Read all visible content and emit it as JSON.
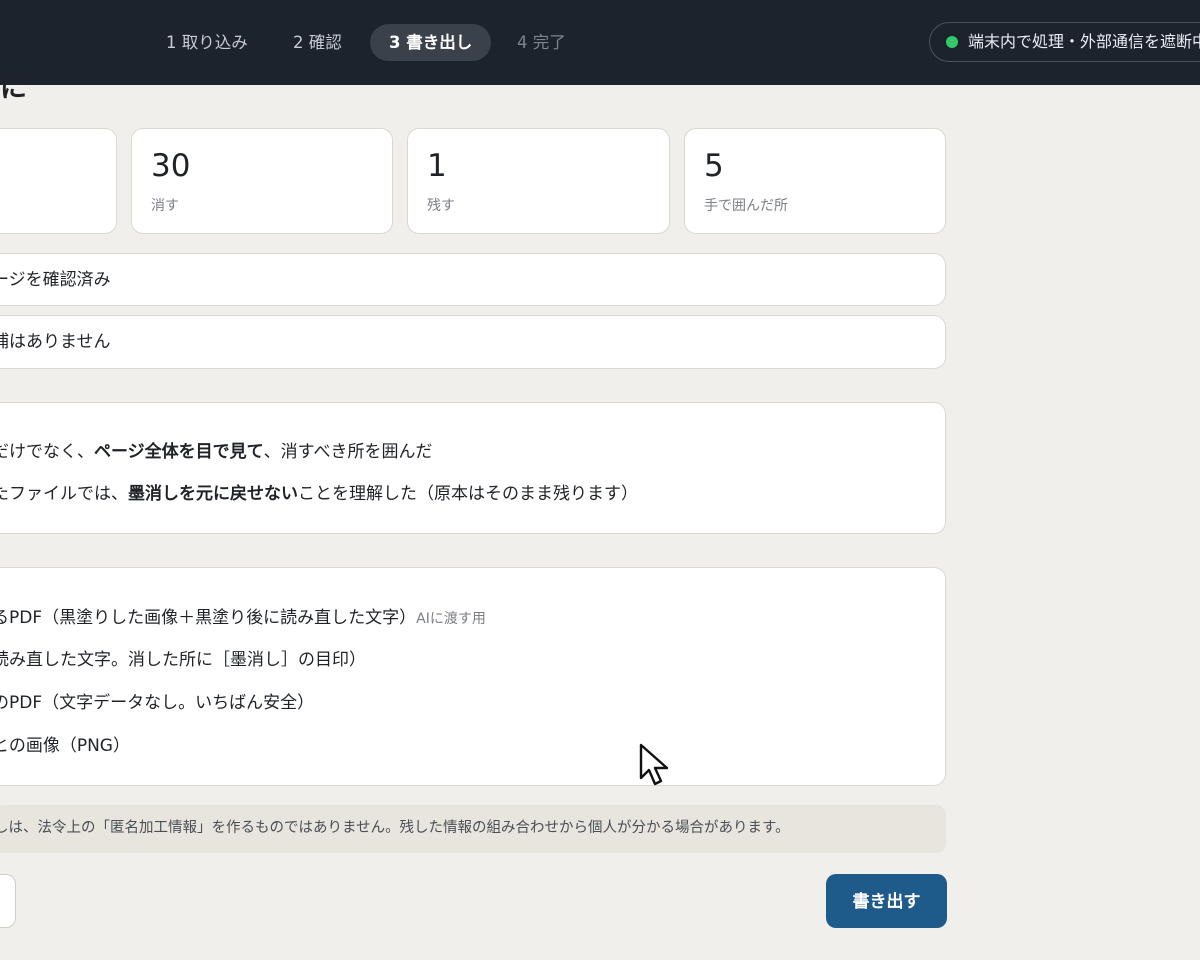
{
  "steps": [
    {
      "label": "1 取り込み",
      "state": "done"
    },
    {
      "label": "2 確認",
      "state": "done"
    },
    {
      "label": "3 書き出し",
      "state": "active"
    },
    {
      "label": "4 完了",
      "state": "todo"
    }
  ],
  "privacy": {
    "text": "端末内で処理・外部通信を遮断中",
    "status_color": "#34c76b",
    "icon": "status-dot"
  },
  "heading_fragment": "に",
  "stats": [
    {
      "value": "30",
      "label": "消す"
    },
    {
      "value": "1",
      "label": "残す"
    },
    {
      "value": "5",
      "label": "手で囲んだ所"
    }
  ],
  "summary_rows": [
    "ージを確認済み",
    "補はありません"
  ],
  "checks": [
    {
      "pre": "だけでなく、",
      "bold": "ページ全体を目で見て",
      "post": "、消すべき所を囲んだ"
    },
    {
      "pre": "たファイルでは、",
      "bold": "墨消しを元に戻せない",
      "post": "ことを理解した（原本はそのまま残ります）"
    }
  ],
  "formats": [
    {
      "text": "るPDF（黒塗りした画像＋黒塗り後に読み直した文字）",
      "note": "AIに渡す用"
    },
    {
      "text": "読み直した文字。消した所に［墨消し］の目印）",
      "note": ""
    },
    {
      "text": "のPDF（文字データなし。いちばん安全）",
      "note": ""
    },
    {
      "text": "との画像（PNG）",
      "note": ""
    }
  ],
  "notice": "しは、法令上の「匿名加工情報」を作るものではありません。残した情報の組み合わせから個人が分かる場合があります。",
  "buttons": {
    "export": "書き出す"
  },
  "colors": {
    "topbar": "#1c232d",
    "accent": "#1f5b8a",
    "background": "#f1efeb"
  }
}
